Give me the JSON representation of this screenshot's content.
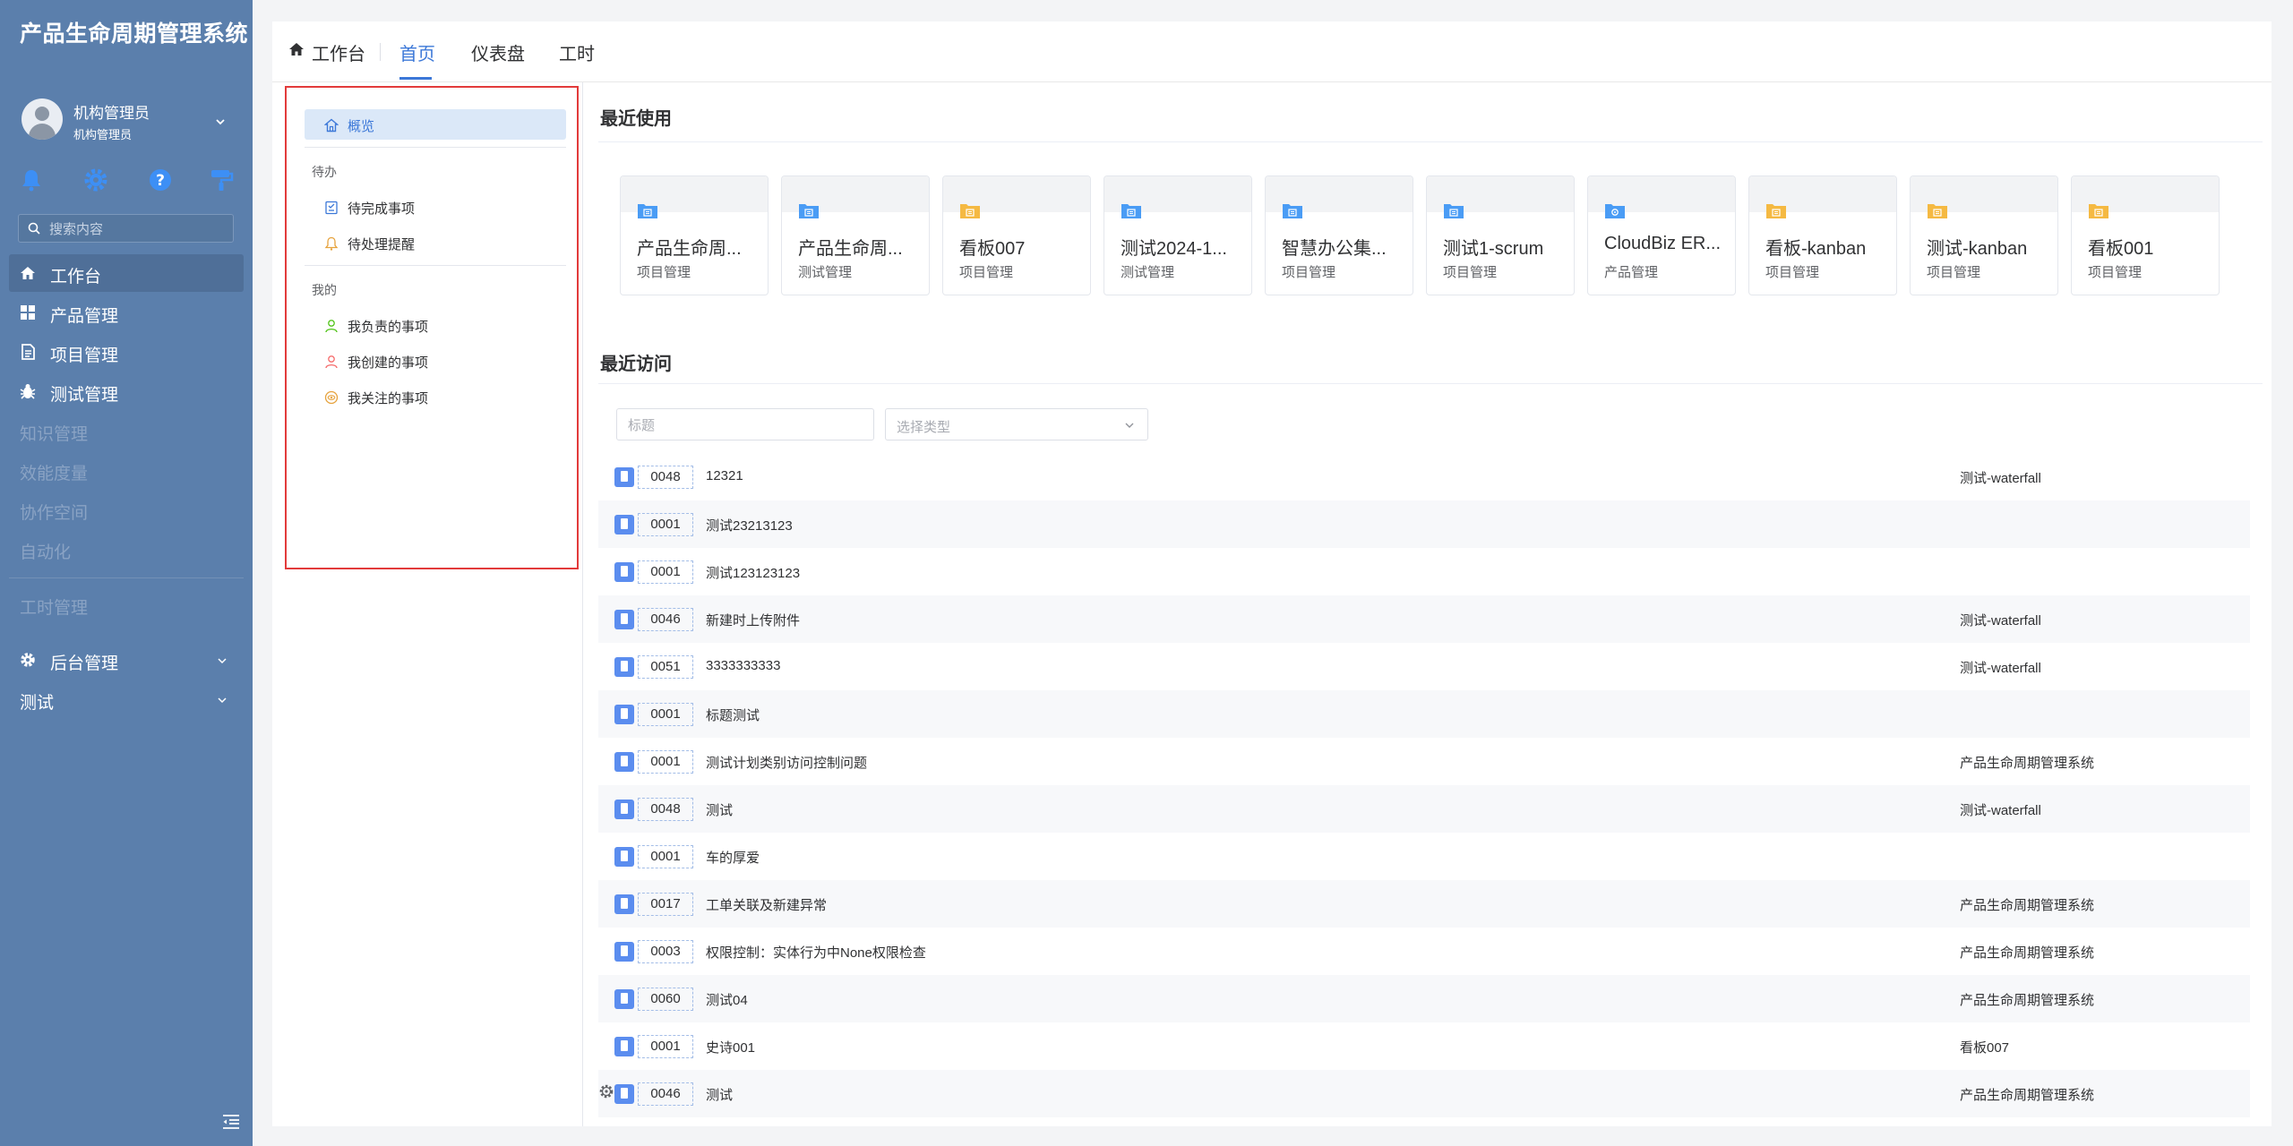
{
  "app_title": "产品生命周期管理系统",
  "user": {
    "name": "机构管理员",
    "role": "机构管理员"
  },
  "quick_icons": [
    "bell-icon",
    "gear-icon",
    "help-icon",
    "paint-roller-icon"
  ],
  "search": {
    "placeholder": "搜索内容"
  },
  "nav": {
    "workbench": "工作台",
    "product": "产品管理",
    "project": "项目管理",
    "test": "测试管理",
    "knowledge": "知识管理",
    "efficiency": "效能度量",
    "collab": "协作空间",
    "automation": "自动化",
    "timesheet": "工时管理",
    "admin": "后台管理",
    "testing": "测试"
  },
  "tabs": {
    "home_label": "工作台",
    "t1": "首页",
    "t2": "仪表盘",
    "t3": "工时"
  },
  "left_panel": {
    "overview": "概览",
    "group_todo": "待办",
    "todo_items": [
      "待完成事项",
      "待处理提醒"
    ],
    "group_mine": "我的",
    "mine_items": [
      "我负责的事项",
      "我创建的事项",
      "我关注的事项"
    ]
  },
  "recent_used": {
    "title": "最近使用",
    "cards": [
      {
        "title": "产品生命周...",
        "type": "项目管理",
        "icon": "blue-folder-icon"
      },
      {
        "title": "产品生命周...",
        "type": "测试管理",
        "icon": "blue-folder-icon"
      },
      {
        "title": "看板007",
        "type": "项目管理",
        "icon": "yellow-folder-icon"
      },
      {
        "title": "测试2024-1...",
        "type": "测试管理",
        "icon": "blue-folder-icon"
      },
      {
        "title": "智慧办公集...",
        "type": "项目管理",
        "icon": "blue-folder-icon"
      },
      {
        "title": "测试1-scrum",
        "type": "项目管理",
        "icon": "blue-folder-icon"
      },
      {
        "title": "CloudBiz ER...",
        "type": "产品管理",
        "icon": "blue-product-icon"
      },
      {
        "title": "看板-kanban",
        "type": "项目管理",
        "icon": "yellow-folder-icon"
      },
      {
        "title": "测试-kanban",
        "type": "项目管理",
        "icon": "yellow-folder-icon"
      },
      {
        "title": "看板001",
        "type": "项目管理",
        "icon": "yellow-folder-icon"
      }
    ]
  },
  "recent_visited": {
    "title": "最近访问",
    "filter_placeholder": "标题",
    "type_placeholder": "选择类型",
    "rows": [
      {
        "id": "0048",
        "title": "12321",
        "project": "测试-waterfall"
      },
      {
        "id": "0001",
        "title": "测试23213123",
        "project": ""
      },
      {
        "id": "0001",
        "title": "测试123123123",
        "project": ""
      },
      {
        "id": "0046",
        "title": "新建时上传附件",
        "project": "测试-waterfall"
      },
      {
        "id": "0051",
        "title": "3333333333",
        "project": "测试-waterfall"
      },
      {
        "id": "0001",
        "title": "标题测试",
        "project": ""
      },
      {
        "id": "0001",
        "title": "测试计划类别访问控制问题",
        "project": "产品生命周期管理系统"
      },
      {
        "id": "0048",
        "title": "测试",
        "project": "测试-waterfall"
      },
      {
        "id": "0001",
        "title": "车的厚爱",
        "project": ""
      },
      {
        "id": "0017",
        "title": "工单关联及新建异常",
        "project": "产品生命周期管理系统"
      },
      {
        "id": "0003",
        "title": "权限控制：实体行为中None权限检查",
        "project": "产品生命周期管理系统"
      },
      {
        "id": "0060",
        "title": "测试04",
        "project": "产品生命周期管理系统"
      },
      {
        "id": "0001",
        "title": "史诗001",
        "project": "看板007"
      },
      {
        "id": "0046",
        "title": "测试",
        "project": "产品生命周期管理系统"
      }
    ]
  },
  "colors": {
    "sidebar": "#5b7fac",
    "accent": "#3c78d8",
    "highlight_border": "#e23b3b"
  }
}
